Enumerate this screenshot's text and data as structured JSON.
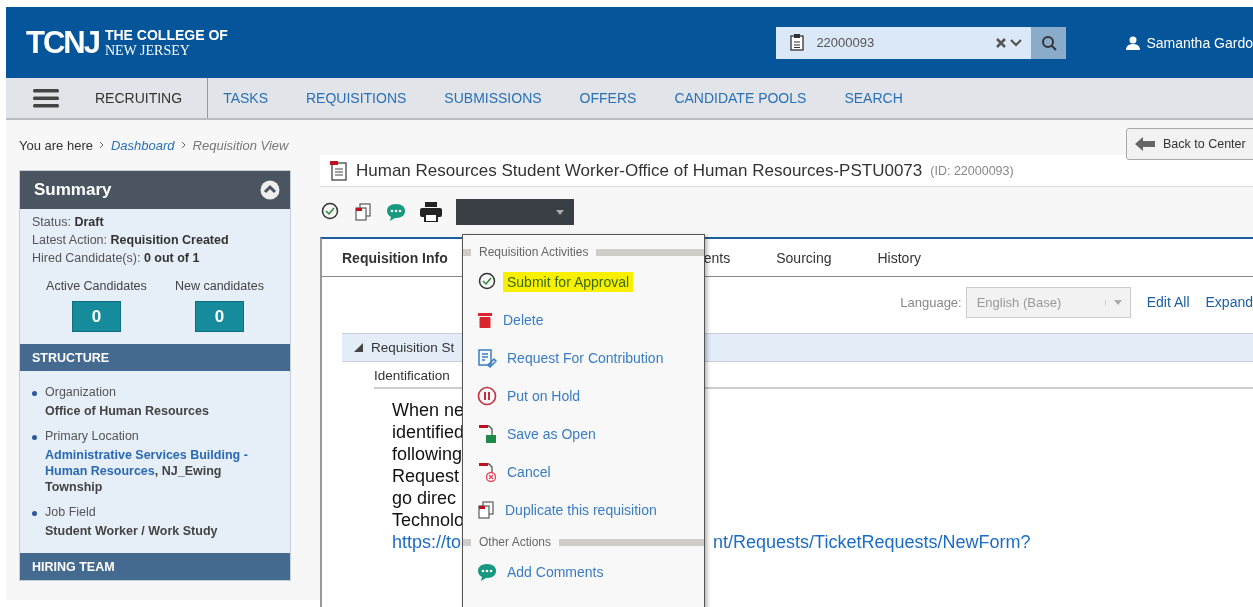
{
  "header": {
    "logo_mark": "TCNJ",
    "logo_line_1": "THE COLLEGE OF",
    "logo_line_2": "NEW JERSEY",
    "search": {
      "value": "22000093"
    },
    "user": "Samantha Gardo"
  },
  "nav": {
    "module": "RECRUITING",
    "items": [
      {
        "label": "TASKS",
        "selected": false
      },
      {
        "label": "REQUISITIONS",
        "selected": false
      },
      {
        "label": "SUBMISSIONS",
        "selected": false
      },
      {
        "label": "OFFERS",
        "selected": false
      },
      {
        "label": "CANDIDATE POOLS",
        "selected": false
      },
      {
        "label": "SEARCH",
        "selected": false
      }
    ]
  },
  "breadcrumb": {
    "prefix": "You are here",
    "items": [
      {
        "label": "Dashboard",
        "link": true
      },
      {
        "label": "Requisition View",
        "link": false
      }
    ]
  },
  "back_button": "Back to Center",
  "summary": {
    "title": "Summary",
    "expanded": true,
    "facts": [
      {
        "label": "Status:",
        "value": "Draft"
      },
      {
        "label": "Latest Action:",
        "value": "Requisition Created"
      },
      {
        "label": "Hired Candidate(s):",
        "value": "0 out of 1"
      }
    ],
    "counters": [
      {
        "label": "Active Candidates",
        "value": "0"
      },
      {
        "label": "New candidates",
        "value": "0"
      }
    ],
    "structure_title": "STRUCTURE",
    "structure": [
      {
        "label": "Organization",
        "value": "Office of Human Resources",
        "link": false
      },
      {
        "label": "Primary Location",
        "value": "Administrative Services Building - Human Resources",
        "suffix": ", NJ_Ewing Township",
        "link": true
      },
      {
        "label": "Job Field",
        "value": "Student Worker / Work Study",
        "link": false
      }
    ],
    "hiring_team_title": "HIRING TEAM"
  },
  "requisition": {
    "title": "Human Resources Student Worker-Office of Human Resources-PSTU0073",
    "id": "(ID: 22000093)"
  },
  "tabs": [
    {
      "label": "Requisition Info",
      "selected": true
    },
    {
      "label": "ents",
      "selected": false
    },
    {
      "label": "Sourcing",
      "selected": false
    },
    {
      "label": "History",
      "selected": false
    }
  ],
  "language": {
    "label": "Language:",
    "value": "English (Base)",
    "disabled": true
  },
  "links": [
    "Edit All",
    "Expand"
  ],
  "section": {
    "title": "Requisition St",
    "expanded": true,
    "field": "Identification"
  },
  "body_lines": [
    "When ne",
    "identified",
    "following",
    "Request",
    "go direc",
    "Technolo"
  ],
  "body_link": {
    "left": "https://to",
    "right": "nt/Requests/TicketRequests/NewForm?"
  },
  "menu": {
    "groups": [
      {
        "title": "Requisition Activities",
        "items": [
          {
            "label": "Submit for Approval",
            "kind": "approve",
            "highlighted": true
          },
          {
            "label": "Delete",
            "kind": "trash",
            "highlighted": false
          },
          {
            "label": "Request For Contribution",
            "kind": "contribution",
            "highlighted": false
          },
          {
            "label": "Put on Hold",
            "kind": "hold",
            "highlighted": false
          },
          {
            "label": "Save as Open",
            "kind": "save",
            "highlighted": false
          },
          {
            "label": "Cancel",
            "kind": "cancel",
            "highlighted": false
          },
          {
            "label": "Duplicate this requisition",
            "kind": "duplicate",
            "highlighted": false
          }
        ]
      },
      {
        "title": "Other Actions",
        "items": [
          {
            "label": "Add Comments",
            "kind": "comment",
            "highlighted": false
          }
        ]
      }
    ]
  }
}
